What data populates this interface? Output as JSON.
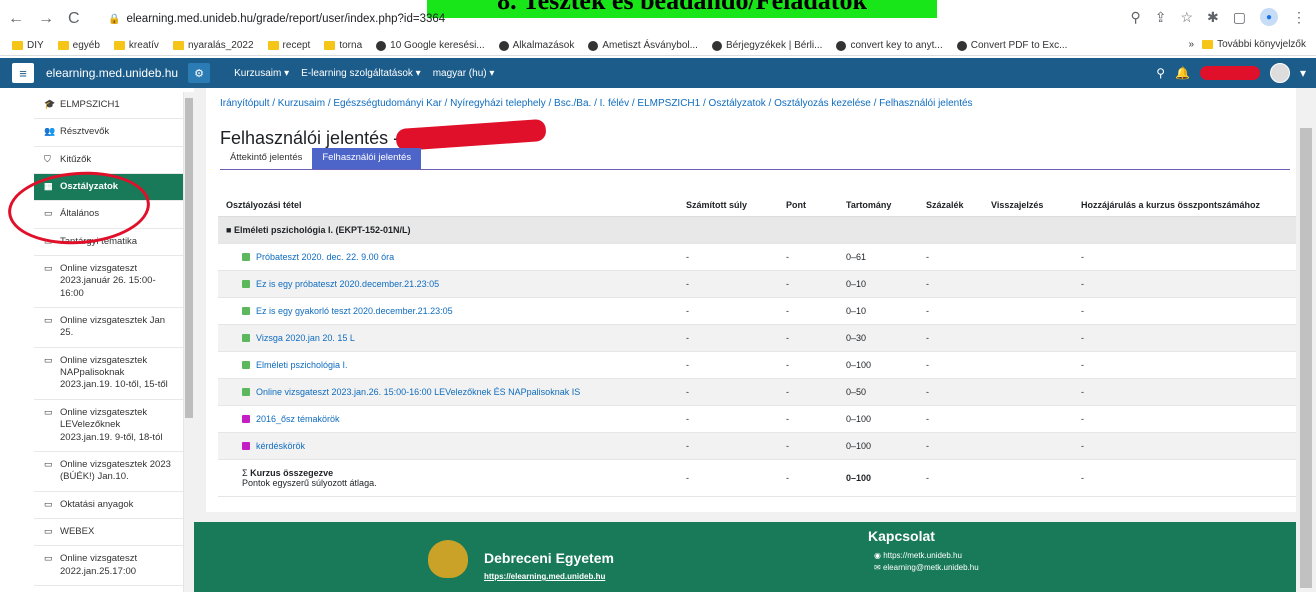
{
  "browser": {
    "banner": "8. Tesztek és beadandó/Feladatok",
    "url": "elearning.med.unideb.hu/grade/report/user/index.php?id=3364",
    "bookmarks": [
      "DIY",
      "egyéb",
      "kreatív",
      "nyaralás_2022",
      "recept",
      "torna",
      "10 Google keresési...",
      "Alkalmazások",
      "Ametiszt Ásványbol...",
      "Bérjegyzékek | Bérli...",
      "convert key to anyt...",
      "Convert PDF to Exc..."
    ],
    "bookmarks_more": "»",
    "other_bookmarks": "További könyvjelzők"
  },
  "navbar": {
    "brand": "elearning.med.unideb.hu",
    "menu": [
      "Kurzusaim ▾",
      "E-learning szolgáltatások ▾",
      "magyar (hu) ▾"
    ]
  },
  "sidebar": {
    "items": [
      {
        "icon": "graduation-icon",
        "glyph": "🎓",
        "label": "ELMPSZICH1",
        "active": false
      },
      {
        "icon": "users-icon",
        "glyph": "👥",
        "label": "Résztvevők",
        "active": false
      },
      {
        "icon": "shield-icon",
        "glyph": "⛉",
        "label": "Kitűzők",
        "active": false
      },
      {
        "icon": "table-icon",
        "glyph": "▦",
        "label": "Osztályzatok",
        "active": true
      },
      {
        "icon": "folder-icon",
        "glyph": "▭",
        "label": "Általános",
        "active": false
      },
      {
        "icon": "folder-icon",
        "glyph": "▭",
        "label": "Tantárgyi tematika",
        "active": false
      },
      {
        "icon": "folder-icon",
        "glyph": "▭",
        "label": "Online vizsgateszt 2023.január 26. 15:00-16:00",
        "active": false
      },
      {
        "icon": "folder-icon",
        "glyph": "▭",
        "label": "Online vizsgatesztek Jan 25.",
        "active": false
      },
      {
        "icon": "folder-icon",
        "glyph": "▭",
        "label": "Online vizsgatesztek NAPpalisoknak 2023.jan.19. 10-től, 15-től",
        "active": false
      },
      {
        "icon": "folder-icon",
        "glyph": "▭",
        "label": "Online vizsgatesztek LEVelezőknek 2023.jan.19. 9-től, 18-tól",
        "active": false
      },
      {
        "icon": "folder-icon",
        "glyph": "▭",
        "label": "Online vizsgatesztek 2023 (BÚÉK!) Jan.10.",
        "active": false
      },
      {
        "icon": "folder-icon",
        "glyph": "▭",
        "label": "Oktatási anyagok",
        "active": false
      },
      {
        "icon": "folder-icon",
        "glyph": "▭",
        "label": "WEBEX",
        "active": false
      },
      {
        "icon": "folder-icon",
        "glyph": "▭",
        "label": "Online vizsgateszt 2022.jan.25.17:00",
        "active": false
      }
    ]
  },
  "main": {
    "breadcrumb": "Irányítópult / Kurzusaim / Egészségtudományi Kar / Nyíregyházi telephely / Bsc./Ba. / I. félév / ELMPSZICH1 / Osztályzatok / Osztályozás kezelése / Felhasználói jelentés",
    "title": "Felhasználói jelentés -",
    "tabs": [
      "Áttekintő jelentés",
      "Felhasználói jelentés"
    ],
    "columns": [
      "Osztályozási tétel",
      "Számított súly",
      "Pont",
      "Tartomány",
      "Százalék",
      "Visszajelzés",
      "Hozzájárulás a kurzus összpontszámához"
    ],
    "category": "Elméleti pszichológia I. (EKPT-152-01N/L)",
    "rows": [
      {
        "name": "Próbateszt 2020. dec. 22. 9.00 óra",
        "icon_color": "#5cb85c",
        "weight": "-",
        "points": "-",
        "range": "0–61",
        "percent": "-",
        "contribution": "-"
      },
      {
        "name": "Ez is egy próbateszt 2020.december.21.23:05",
        "icon_color": "#5cb85c",
        "weight": "-",
        "points": "-",
        "range": "0–10",
        "percent": "-",
        "contribution": "-"
      },
      {
        "name": "Ez is egy gyakorló teszt 2020.december.21.23:05",
        "icon_color": "#5cb85c",
        "weight": "-",
        "points": "-",
        "range": "0–10",
        "percent": "-",
        "contribution": "-"
      },
      {
        "name": "Vizsga 2020.jan 20. 15 L",
        "icon_color": "#5cb85c",
        "weight": "-",
        "points": "-",
        "range": "0–30",
        "percent": "-",
        "contribution": "-"
      },
      {
        "name": "Elméleti pszichológia I.",
        "icon_color": "#5cb85c",
        "weight": "-",
        "points": "-",
        "range": "0–100",
        "percent": "-",
        "contribution": "-"
      },
      {
        "name": "Online vizsgateszt 2023.jan.26. 15:00-16:00 LEVelezőknek ÉS NAPpalisoknak IS",
        "icon_color": "#5cb85c",
        "weight": "-",
        "points": "-",
        "range": "0–50",
        "percent": "-",
        "contribution": "-"
      },
      {
        "name": "2016_ősz témakörök",
        "icon_color": "#c41fc4",
        "weight": "-",
        "points": "-",
        "range": "0–100",
        "percent": "-",
        "contribution": "-"
      },
      {
        "name": "kérdéskörök",
        "icon_color": "#c41fc4",
        "weight": "-",
        "points": "-",
        "range": "0–100",
        "percent": "-",
        "contribution": "-"
      }
    ],
    "summary": {
      "name": "Kurzus összegezve",
      "sub": "Pontok egyszerű súlyozott átlaga.",
      "weight": "-",
      "points": "-",
      "range": "0–100",
      "percent": "-",
      "contribution": "-"
    }
  },
  "footer": {
    "university": "Debreceni Egyetem",
    "university_url": "https://elearning.med.unideb.hu",
    "contact_title": "Kapcsolat",
    "contact_web": "https://metk.unideb.hu",
    "contact_email": "elearning@metk.unideb.hu"
  }
}
